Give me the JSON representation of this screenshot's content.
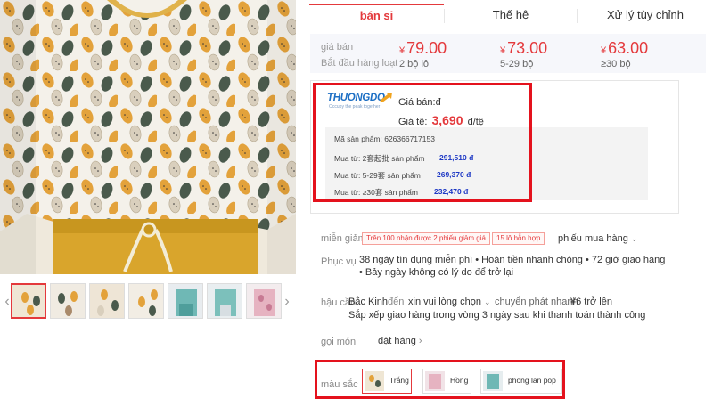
{
  "tabs": [
    {
      "label": "bán si"
    },
    {
      "label": "Thế hệ"
    },
    {
      "label": "Xử lý tùy chỉnh"
    }
  ],
  "price_box": {
    "price_label": "giá bán",
    "batch_label": "Bắt đầu hàng loạt",
    "currency_symbol": "¥",
    "tiers": [
      {
        "price": "79.00",
        "qty": "2 bộ lô"
      },
      {
        "price": "73.00",
        "qty": "5-29 bộ"
      },
      {
        "price": "63.00",
        "qty": "≥30 bộ"
      }
    ]
  },
  "shipping_panel": {
    "logo_text": "THUONGDO",
    "logo_tagline": "Occupy the peak together",
    "price_label": "Giá bán:đ",
    "rate_prefix": "Giá tệ:",
    "rate_value": "3,690",
    "rate_unit": "đ/tệ",
    "product_code": "Mã sản phẩm: 626366717153",
    "rows": [
      {
        "label": "Mua từ: 2套起批 sản phẩm",
        "value": "291,510 đ"
      },
      {
        "label": "Mua từ: 5-29套 sản phẩm",
        "value": "269,370 đ"
      },
      {
        "label": "Mua từ: ≥30套 sản phẩm",
        "value": "232,470 đ"
      }
    ]
  },
  "discount": {
    "label": "miễn giảm",
    "badges": [
      "Trên 100 nhận được 2 phiếu giảm giá",
      "15 lô hỗn hợp"
    ],
    "coupon_link": "phiếu mua hàng"
  },
  "service": {
    "label": "Phục vụ",
    "line1": "38 ngày tín dụng miễn phí • Hoàn tiền nhanh chóng • 72 giờ giao hàng",
    "line2": "• Bảy ngày không có lý do để trở lại"
  },
  "logistics": {
    "label": "hậu cần",
    "origin": "Bắc Kinh",
    "to_label": "đến",
    "destination": "xin vui lòng chọn",
    "method": "chuyển phát nhanh",
    "fee": "¥6 trở lên",
    "note": "Sắp xếp giao hàng trong vòng 3 ngày sau khi thanh toán thành công"
  },
  "package": {
    "label": "gọi món",
    "value": "đặt hàng"
  },
  "colors": {
    "label": "màu sắc",
    "options": [
      {
        "label": "Trắng"
      },
      {
        "label": "Hồng"
      },
      {
        "label": "phong lan pop"
      }
    ]
  },
  "icons": {
    "left_arrow": "chevron-left-icon",
    "right_arrow": "chevron-right-icon",
    "dropdown": "chevron-down-icon"
  },
  "accent_color": "#e4393c",
  "highlight_box_color": "#e4121d"
}
